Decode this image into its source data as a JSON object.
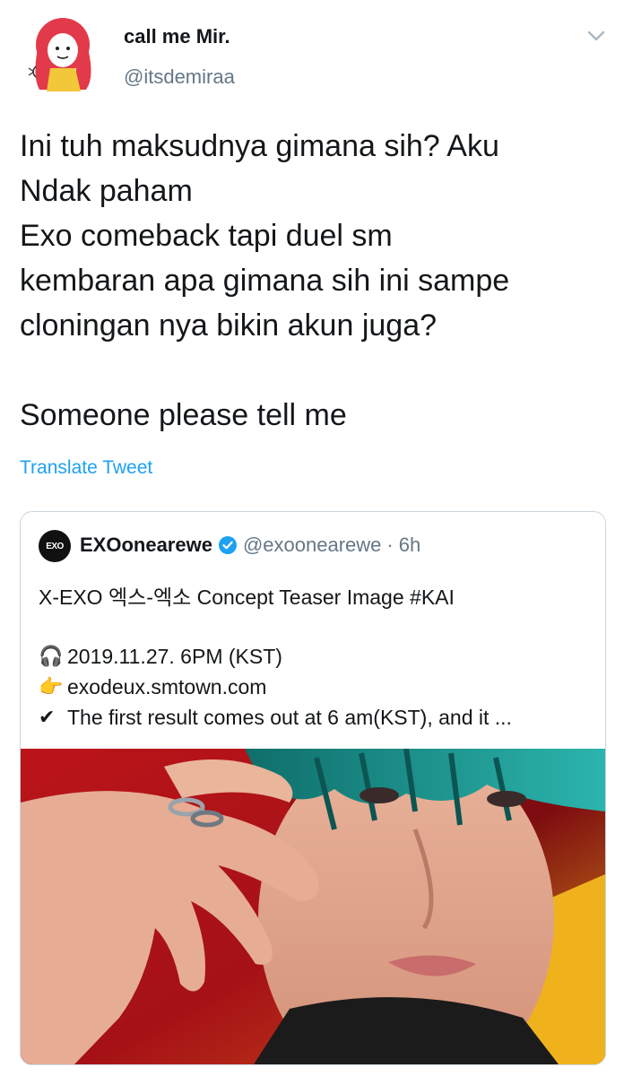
{
  "tweet": {
    "display_name": "call me Mir.",
    "handle": "@itsdemiraa",
    "text": "Ini tuh maksudnya gimana sih? Aku\nNdak paham\nExo comeback tapi duel sm\nkembaran apa gimana sih ini sampe\ncloningan nya bikin akun juga?\n\nSomeone please tell me",
    "translate_label": "Translate Tweet"
  },
  "quote": {
    "avatar_text": "EXO",
    "name": "EXOonearewe",
    "handle": "@exoonearewe",
    "separator": "·",
    "time": "6h",
    "line1": "X-EXO 엑스-엑소 Concept Teaser Image #KAI",
    "lines": [
      {
        "icon": "🎧",
        "text": "2019.11.27. 6PM (KST)"
      },
      {
        "icon": "👉",
        "text": "exodeux.smtown.com"
      },
      {
        "icon": "✔",
        "text": "The first result comes out at 6 am(KST), and it ..."
      }
    ]
  },
  "colors": {
    "link": "#1da1f2",
    "secondary_text": "#657786",
    "verified": "#1da1f2",
    "border": "#ccd6dd"
  },
  "icons": {
    "menu": "chevron-down-icon",
    "verified": "verified-badge-icon"
  }
}
